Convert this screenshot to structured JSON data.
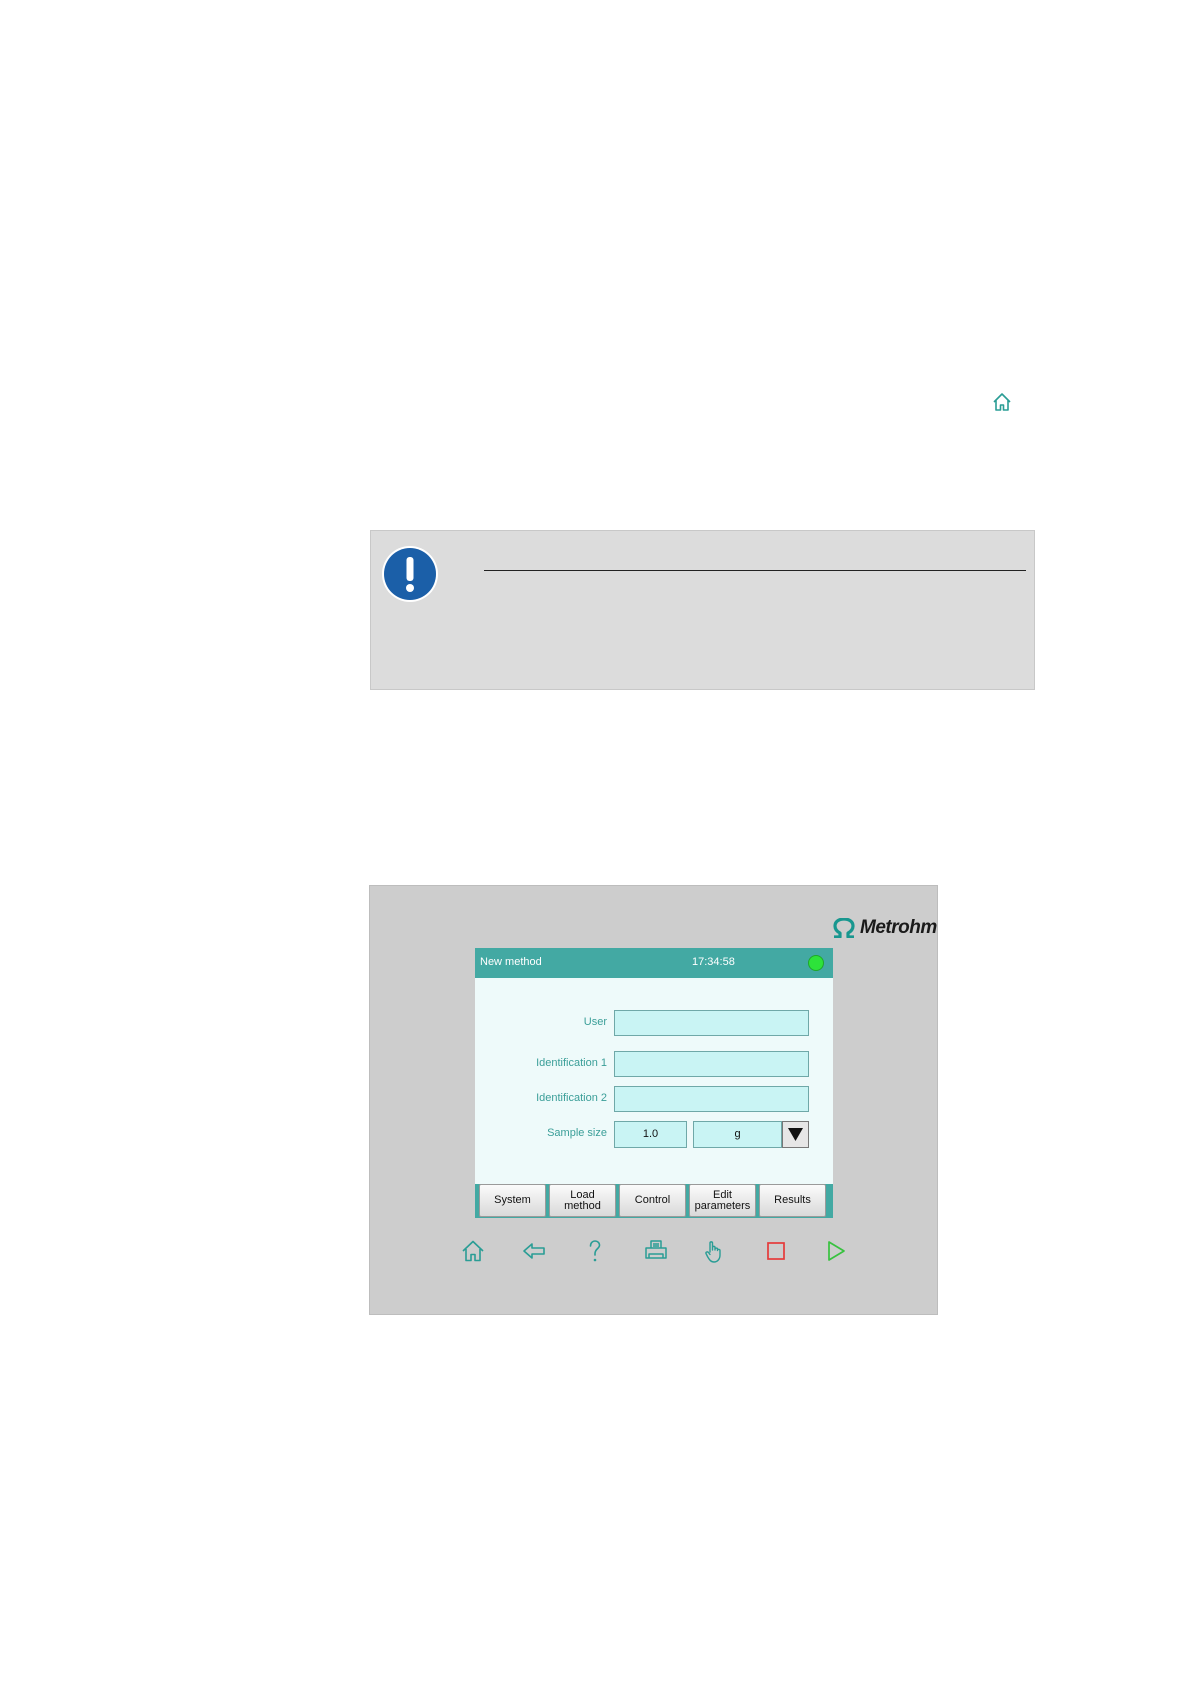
{
  "note": {
    "icon": "exclamation-icon"
  },
  "device": {
    "logo": {
      "icon": "omega-icon",
      "text": "Metrohm"
    },
    "screen": {
      "title": "New method",
      "clock": "17:34:58",
      "status_color": "#2de33a",
      "fields": {
        "user": {
          "label": "User",
          "value": ""
        },
        "id1": {
          "label": "Identification 1",
          "value": ""
        },
        "id2": {
          "label": "Identification 2",
          "value": ""
        },
        "sample_size": {
          "label": "Sample size",
          "value": "1.0",
          "unit": "g"
        }
      },
      "softkeys": {
        "system": "System",
        "load_line1": "Load",
        "load_line2": "method",
        "control": "Control",
        "edit_line1": "Edit",
        "edit_line2": "parameters",
        "results": "Results"
      }
    },
    "hardware_keys": [
      "home-icon",
      "back-icon",
      "help-icon",
      "print-icon",
      "manual-icon",
      "stop-icon",
      "start-icon"
    ]
  },
  "colors": {
    "teal": "#43a9a3",
    "field_bg": "#c9f4f4",
    "stop": "#e53b3b",
    "start": "#38c23f"
  }
}
